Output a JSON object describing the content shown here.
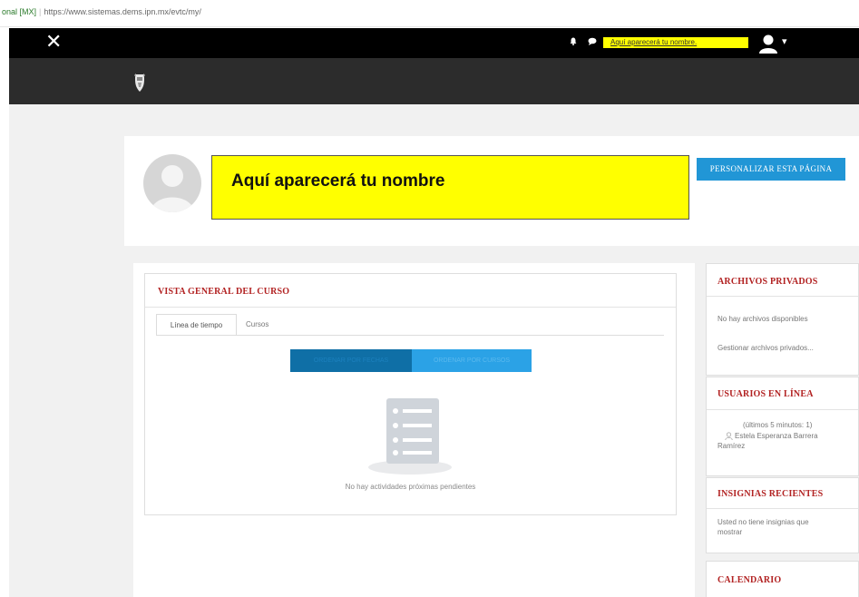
{
  "browser": {
    "site_label": "onal [MX]",
    "url": "https://www.sistemas.dems.ipn.mx/evtc/my/"
  },
  "topnav": {
    "close_glyph": "✕",
    "user_name_link": "Aquí aparecerá tu nombre.",
    "caret": "▾",
    "icons": [
      "close-icon",
      "bell-icon",
      "chat-icon",
      "user-avatar-icon",
      "chevron-down-icon"
    ]
  },
  "banner": {
    "logo": "ipn-logo"
  },
  "profile": {
    "name": "Aquí aparecerá tu nombre",
    "customize_button": "PERSONALIZAR ESTA PÁGINA"
  },
  "course_overview": {
    "title": "VISTA GENERAL DEL CURSO",
    "tabs": [
      {
        "label": "Línea de tiempo",
        "active": true
      },
      {
        "label": "Cursos",
        "active": false
      }
    ],
    "sort_buttons": [
      "ORDENAR POR FECHAS",
      "ORDENAR POR CURSOS"
    ],
    "empty_message": "No hay actividades próximas pendientes"
  },
  "sidebar": {
    "private_files": {
      "title": "ARCHIVOS PRIVADOS",
      "empty": "No hay archivos disponibles",
      "manage_link": "Gestionar archivos privados..."
    },
    "online_users": {
      "title": "USUARIOS EN LÍNEA",
      "period": "(últimos 5 minutos: 1)",
      "user_line1": "Estela Esperanza Barrera",
      "user_line2": "Ramírez"
    },
    "recent_badges": {
      "title": "INSIGNIAS RECIENTES",
      "line1": "Usted no tiene insignias que",
      "line2": "mostrar"
    },
    "calendar": {
      "title": "CALENDARIO"
    }
  },
  "colors": {
    "accent_red": "#b22222",
    "button_blue": "#2196d6",
    "highlight_yellow": "#ffff00",
    "nav_black": "#000000",
    "banner_dark": "#2c2c2c"
  }
}
